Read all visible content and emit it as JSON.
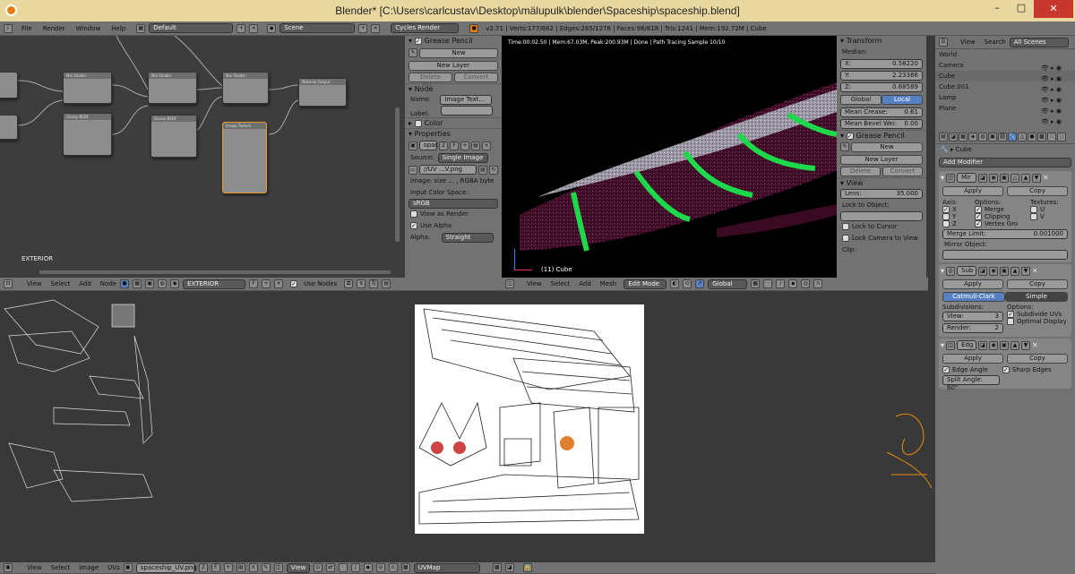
{
  "window": {
    "title": "Blender* [C:\\Users\\carlcustav\\Desktop\\mälupulk\\blender\\Spaceship\\spaceship.blend]",
    "minimize": "–",
    "maximize": "□",
    "close": "✕"
  },
  "info": {
    "menus": [
      "File",
      "Render",
      "Window",
      "Help"
    ],
    "layout": "Default",
    "scene": "Scene",
    "engine": "Cycles Render",
    "stats": "v2.71 | Verts:177/662 | Edges:265/1276 | Faces:96/618 | Tris:1241 | Mem:192.72M | Cube"
  },
  "node_editor": {
    "label": "EXTERIOR",
    "menus": [
      "View",
      "Select",
      "Add",
      "Node"
    ],
    "material": "EXTERIOR",
    "mat_btn": "F",
    "use_nodes": "Use Nodes",
    "nodes": {
      "mix1": "Mix Shader",
      "mix2": "Mix Shader",
      "mix3": "Mix Shader",
      "out": "Material Output",
      "gloss1": "Glossy BSDF",
      "gloss2": "Glossy BSDF",
      "img": "Image Texture"
    }
  },
  "node_panel": {
    "grease_pencil": "Grease Pencil",
    "new": "New",
    "new_layer": "New Layer",
    "delete_frame": "Delete Fra...",
    "convert": "Convert",
    "node": "Node",
    "name_label": "Name:",
    "name_value": "Image Text...",
    "label_label": "Label:",
    "color": "Color",
    "properties": "Properties",
    "img_name": "spac",
    "img_users": "2",
    "img_f": "F",
    "source_label": "Source:",
    "source_value": "Single Image",
    "filepath": "//UV ...V.png",
    "img_info": "Image: size ... , RGBA byte",
    "input_color_space": "Input Color Space:",
    "color_space": "sRGB",
    "view_as_render": "View as Render",
    "use_alpha": "Use Alpha",
    "alpha_label": "Alpha:",
    "alpha_value": "Straight"
  },
  "viewport": {
    "overlay": "Time:00:02.50 | Mem:67.03M, Peak:200.93M | Done | Path Tracing Sample 10/10",
    "object": "(11) Cube",
    "menus": [
      "View",
      "Select",
      "Add",
      "Mesh"
    ],
    "mode": "Edit Mode",
    "orientation": "Global"
  },
  "transform": {
    "title": "Transform",
    "median": "Median:",
    "x_label": "X:",
    "x": "0.58220",
    "y_label": "Y:",
    "y": "2.23386",
    "z_label": "Z:",
    "z": "0.68589",
    "global": "Global",
    "local": "Local",
    "crease_label": "Mean Crease:",
    "crease": "0.61",
    "bevel_label": "Mean Bevel Wei:",
    "bevel": "0.00",
    "grease_pencil": "Grease Pencil",
    "new": "New",
    "new_layer": "New Layer",
    "delete_frame": "Delete Fra...",
    "convert": "Convert",
    "view": "View",
    "lens_label": "Lens:",
    "lens": "35.000",
    "lock_to_object": "Lock to Object:",
    "lock_to_cursor": "Lock to Cursor",
    "lock_camera": "Lock Camera to View",
    "clip": "Clip:"
  },
  "outliner": {
    "menus": [
      "View",
      "Search"
    ],
    "filter": "All Scenes",
    "items": [
      "World",
      "Camera",
      "Cube",
      "Cube.001",
      "Lamp",
      "Plane"
    ]
  },
  "properties": {
    "object": "Cube",
    "add_modifier": "Add Modifier",
    "mirror": {
      "name": "Mir",
      "apply": "Apply",
      "copy": "Copy",
      "axis": "Axis:",
      "options": "Options:",
      "textures": "Textures:",
      "x": "X",
      "y": "Y",
      "z": "Z",
      "merge": "Merge",
      "clipping": "Clipping",
      "vertex_groups": "Vertex Gro",
      "u": "U",
      "v": "V",
      "merge_limit_label": "Merge Limit:",
      "merge_limit": "0.001000",
      "mirror_object": "Mirror Object:"
    },
    "subsurf": {
      "name": "Sub",
      "apply": "Apply",
      "copy": "Copy",
      "catmull": "Catmull-Clark",
      "simple": "Simple",
      "subdivisions": "Subdivisions:",
      "options": "Options:",
      "view_label": "View:",
      "view": "3",
      "render_label": "Render:",
      "render": "2",
      "subdivide_uvs": "Subdivide UVs",
      "optimal_display": "Optimal Display"
    },
    "edgesplit": {
      "name": "Edg",
      "apply": "Apply",
      "copy": "Copy",
      "edge_angle": "Edge Angle",
      "sharp_edges": "Sharp Edges",
      "split_angle": "Split Angle: 60°"
    }
  },
  "uv_editor": {
    "menus": [
      "View",
      "Select",
      "Image",
      "UVs"
    ],
    "image": "spaceship_UV.png",
    "users": "2",
    "f": "F",
    "view": "View",
    "uvmap": "UVMap"
  }
}
